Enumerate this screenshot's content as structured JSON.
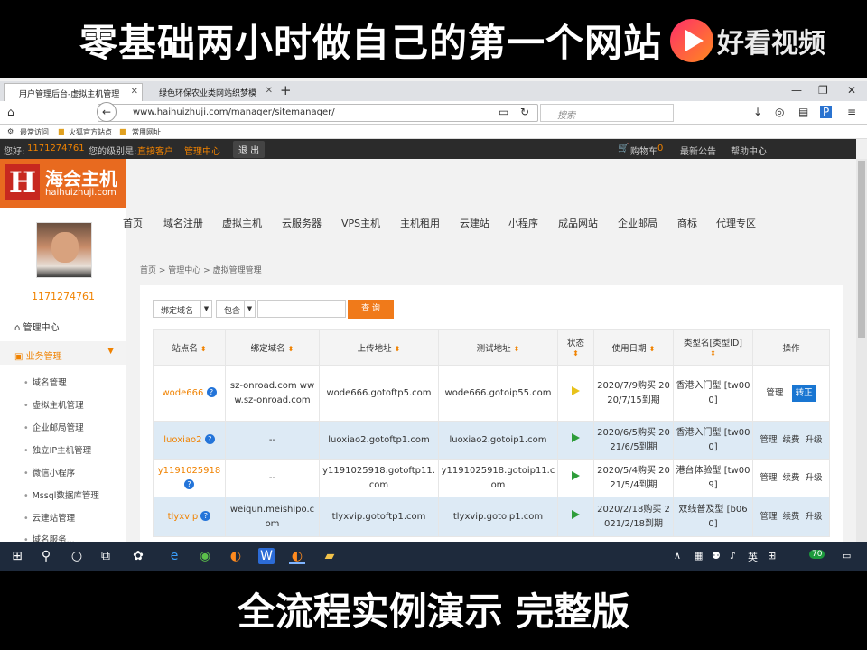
{
  "captions": {
    "top": "零基础两小时做自己的第一个网站",
    "bottom": "全流程实例演示 完整版",
    "watermark": "好看视频"
  },
  "browser": {
    "tabs": [
      {
        "title": "用户管理后台-虚拟主机管理"
      },
      {
        "title": "绿色环保农业类网站织梦模"
      }
    ],
    "url": "www.haihuizhuji.com/manager/sitemanager/",
    "search_placeholder": "搜索",
    "bookmarks": [
      "最常访问",
      "火狐官方站点",
      "常用网址"
    ]
  },
  "site": {
    "greeting": "您好:",
    "user": "1171274761",
    "level_label": "您的级别是:",
    "level": "直接客户",
    "center": "管理中心",
    "logout": "退 出",
    "cart": "购物车",
    "cart_count": "0",
    "notice": "最新公告",
    "help": "帮助中心",
    "logo_text": "海会主机",
    "logo_domain": "haihuizhuji.com"
  },
  "sidebar": {
    "user_id": "1171274761",
    "home": "管理中心",
    "biz": "业务管理",
    "items": [
      "域名管理",
      "虚拟主机管理",
      "企业邮局管理",
      "独立IP主机管理",
      "微信小程序",
      "Mssql数据库管理",
      "云建站管理",
      "域名服务..."
    ]
  },
  "mainnav": [
    "首页",
    "域名注册",
    "虚拟主机",
    "云服务器",
    "VPS主机",
    "主机租用",
    "云建站",
    "小程序",
    "成品网站",
    "企业邮局",
    "商标",
    "代理专区"
  ],
  "breadcrumb": {
    "a": "首页",
    "b": "管理中心",
    "c": "虚拟管理管理"
  },
  "filters": {
    "field": "绑定域名",
    "mode": "包含",
    "query_btn": "查 询"
  },
  "table": {
    "headers": [
      "站点名",
      "绑定域名",
      "上传地址",
      "测试地址",
      "状态",
      "使用日期",
      "类型名[类型ID]",
      "操作"
    ],
    "rows": [
      {
        "site": "wode666",
        "domains": "sz-onroad.com www.sz-onroad.com",
        "upload": "wode666.gotoftp5.com",
        "test": "wode666.gotoip55.com",
        "status": "yellow",
        "dates": "2020/7/9购买 2020/7/15到期",
        "type": "香港入门型 [tw000]",
        "ops": [
          "管理",
          "转正"
        ]
      },
      {
        "site": "luoxiao2",
        "domains": "--",
        "upload": "luoxiao2.gotoftp1.com",
        "test": "luoxiao2.gotoip1.com",
        "status": "green",
        "dates": "2020/6/5购买 2021/6/5到期",
        "type": "香港入门型 [tw000]",
        "ops": [
          "管理",
          "续费",
          "升级"
        ]
      },
      {
        "site": "y1191025918",
        "domains": "--",
        "upload": "y1191025918.gotoftp11.com",
        "test": "y1191025918.gotoip11.com",
        "status": "green",
        "dates": "2020/5/4购买 2021/5/4到期",
        "type": "港台体验型 [tw009]",
        "ops": [
          "管理",
          "续费",
          "升级"
        ]
      },
      {
        "site": "tlyxvip",
        "domains": "weiqun.meishipo.com",
        "upload": "tlyxvip.gotoftp1.com",
        "test": "tlyxvip.gotoip1.com",
        "status": "green",
        "dates": "2020/2/18购买 2021/2/18到期",
        "type": "双线普及型 [b060]",
        "ops": [
          "管理",
          "续费",
          "升级"
        ]
      }
    ]
  },
  "taskbar": {
    "ime": "英",
    "badge": "70"
  }
}
